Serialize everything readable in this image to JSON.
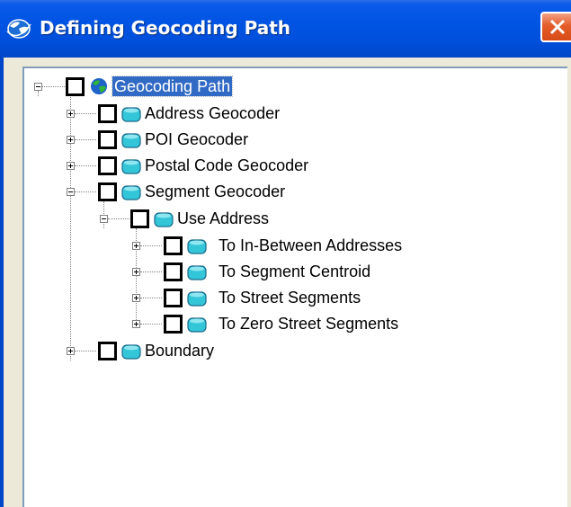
{
  "window": {
    "title": "Defining Geocoding Path",
    "close_icon": "close-icon"
  },
  "tree": {
    "root": {
      "label": "Geocoding Path",
      "icon": "globe-icon",
      "checked": false,
      "expanded": true,
      "selected": true
    },
    "nodes": [
      {
        "label": "Address Geocoder",
        "icon": "database-icon",
        "checked": false,
        "expanded": false
      },
      {
        "label": "POI Geocoder",
        "icon": "database-icon",
        "checked": false,
        "expanded": false
      },
      {
        "label": "Postal Code Geocoder",
        "icon": "database-icon",
        "checked": false,
        "expanded": false
      },
      {
        "label": "Segment Geocoder",
        "icon": "database-icon",
        "checked": false,
        "expanded": true,
        "children": [
          {
            "label": "Use Address",
            "icon": "database-icon",
            "checked": false,
            "expanded": true,
            "children": [
              {
                "label": "To In-Between Addresses",
                "icon": "database-icon",
                "checked": false,
                "expanded": false
              },
              {
                "label": "To Segment Centroid",
                "icon": "database-icon",
                "checked": false,
                "expanded": false
              },
              {
                "label": "To Street Segments",
                "icon": "database-icon",
                "checked": false,
                "expanded": false
              },
              {
                "label": "To Zero Street Segments",
                "icon": "database-icon",
                "checked": false,
                "expanded": false
              }
            ]
          }
        ]
      },
      {
        "label": "Boundary",
        "icon": "database-icon",
        "checked": false,
        "expanded": false
      }
    ]
  },
  "colors": {
    "titlebar": "#0054e3",
    "selection": "#316ac5",
    "close_button": "#e35c2a",
    "node_icon": "#33c6d8"
  }
}
